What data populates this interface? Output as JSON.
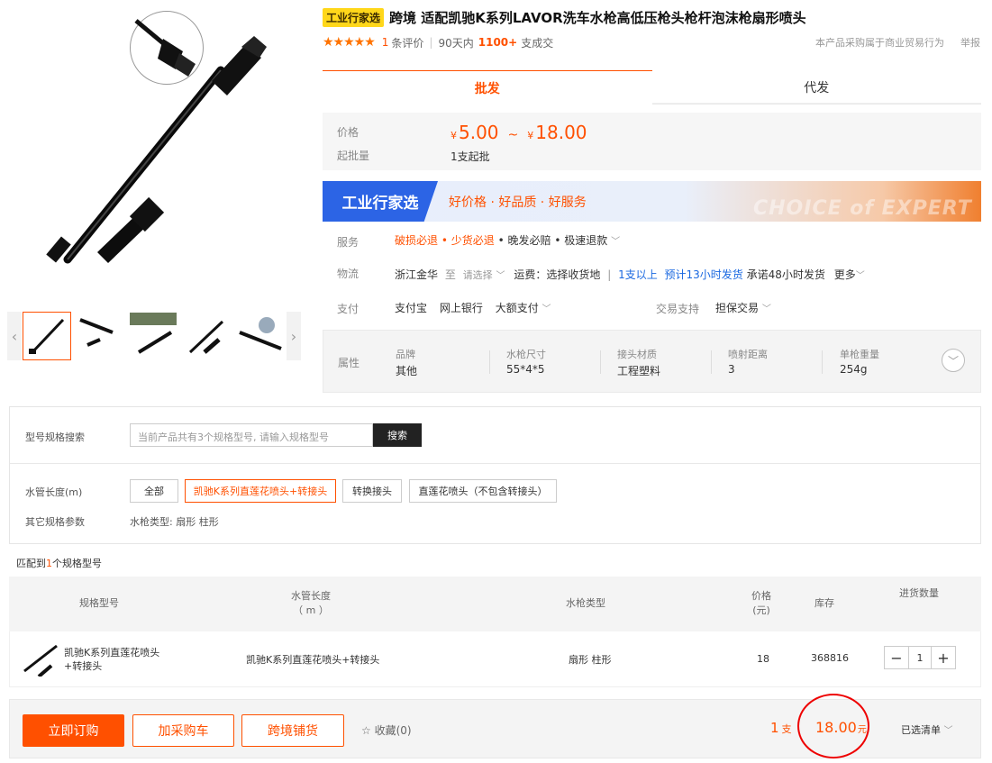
{
  "product": {
    "badge": "工业行家选",
    "title": "跨境 适配凯驰K系列LAVOR洗车水枪高低压枪头枪杆泡沫枪扇形喷头",
    "rating": {
      "stars": 5,
      "review_count": "1",
      "review_label": "条评价",
      "days_label": "90天内",
      "deals": "1100+",
      "deals_label": "支成交"
    },
    "right_links": [
      "本产品采购属于商业贸易行为",
      "举报"
    ]
  },
  "tabs": [
    "批发",
    "代发"
  ],
  "price": {
    "label": "价格",
    "currency": "¥",
    "min": "5.00",
    "tilde": "~",
    "max": "18.00",
    "moq_label": "起批量",
    "moq_value": "1支起批"
  },
  "banner": {
    "brand": "工业行家选",
    "slogan": "好价格 · 好品质 · 好服务",
    "watermark": "CHOICE of EXPERT"
  },
  "service": {
    "label": "服务",
    "items": [
      "破损必退",
      "少货必退",
      "晚发必赔",
      "极速退款"
    ]
  },
  "logistics": {
    "label": "物流",
    "origin": "浙江金华",
    "to": "至",
    "select": "请选择",
    "fee": "运费：选择收货地",
    "ship_qty": "1支以上",
    "ship_time": "预计13小时发货",
    "promise": "承诺48小时发货",
    "more": "更多"
  },
  "payment": {
    "label": "支付",
    "methods": [
      "支付宝",
      "网上银行",
      "大额支付"
    ],
    "trade_label": "交易支持",
    "trade_value": "担保交易"
  },
  "attributes": {
    "label": "属性",
    "items": [
      {
        "name": "品牌",
        "value": "其他"
      },
      {
        "name": "水枪尺寸",
        "value": "55*4*5"
      },
      {
        "name": "接头材质",
        "value": "工程塑料"
      },
      {
        "name": "喷射距离",
        "value": "3"
      },
      {
        "name": "单枪重量",
        "value": "254g"
      }
    ]
  },
  "spec_search": {
    "label": "型号规格搜索",
    "placeholder": "当前产品共有3个规格型号, 请输入规格型号",
    "button": "搜索"
  },
  "spec_filter": {
    "hose_label": "水管长度(m)",
    "options": [
      "全部",
      "凯驰K系列直莲花喷头+转接头",
      "转换接头",
      "直莲花喷头（不包含转接头）"
    ],
    "other_label": "其它规格参数",
    "other_value": "水枪类型: 扇形 柱形"
  },
  "match": {
    "prefix": "匹配到",
    "count": "1",
    "suffix": "个规格型号"
  },
  "table": {
    "headers": {
      "model": "规格型号",
      "hose": "水管长度",
      "hose_unit": "（ m ）",
      "gun_type": "水枪类型",
      "price": "价格",
      "price_unit": "(元)",
      "stock": "库存",
      "qty": "进货数量"
    },
    "rows": [
      {
        "model": "凯驰K系列直莲花喷头+转接头",
        "hose": "凯驰K系列直莲花喷头+转接头",
        "gun_type": "扇形 柱形",
        "price": "18",
        "stock": "368816",
        "qty": "1"
      }
    ]
  },
  "bottom": {
    "buy_now": "立即订购",
    "add_cart": "加采购车",
    "cross_border": "跨境铺货",
    "fav": "收藏(0)",
    "qty": "1",
    "qty_unit": "支",
    "total": "18.00",
    "total_unit": "元",
    "selected": "已选清单"
  },
  "colors": {
    "accent": "#ff5000",
    "blue": "#1a68e0",
    "badge": "#ffd71a",
    "banner_blue": "#2c64e5"
  }
}
